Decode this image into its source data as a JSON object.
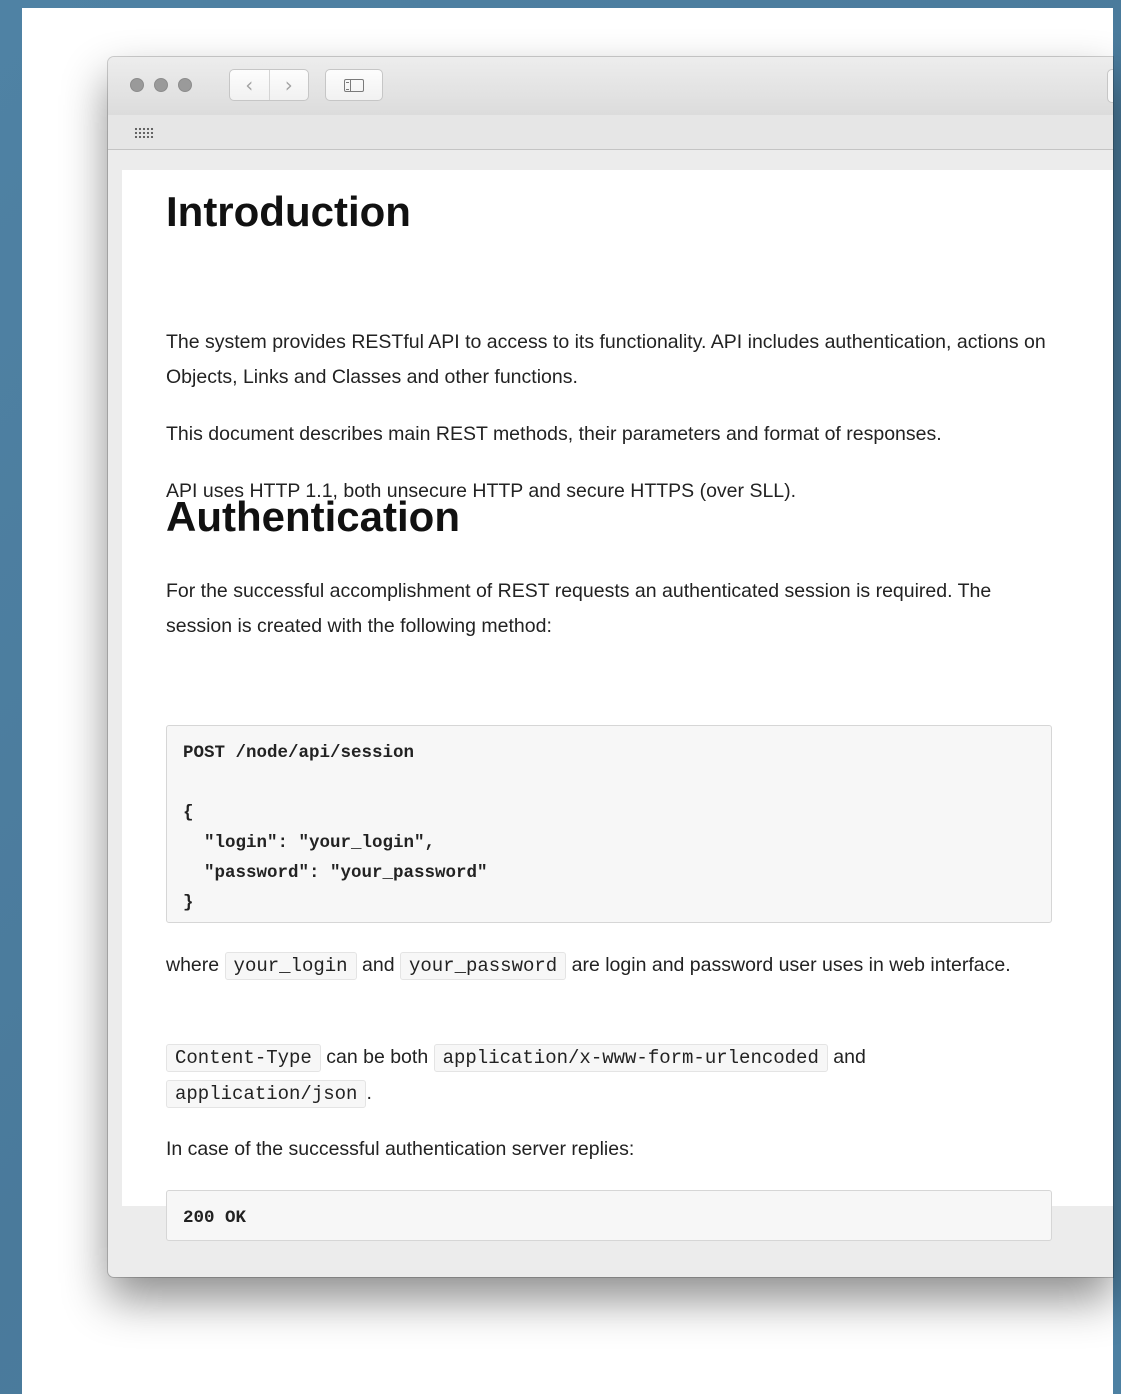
{
  "browser": {
    "back_glyph": "‹",
    "forward_glyph": "›",
    "icons": [
      "close-icon",
      "minimize-icon",
      "zoom-icon",
      "back-arrow-icon",
      "forward-arrow-icon",
      "sidebar-icon",
      "apps-grid-icon"
    ]
  },
  "doc": {
    "intro": {
      "heading": "Introduction",
      "p1": "The system provides RESTful API to access to its functionality. API includes authentication, actions on Objects, Links and Classes and other functions.",
      "p2": "This document describes main REST methods, their parameters and format of responses.",
      "p3": "API uses HTTP 1.1, both unsecure HTTP and secure HTTPS (over SLL)."
    },
    "auth": {
      "heading": "Authentication",
      "p1": "For the successful accomplishment of REST requests an authenticated session is required. The session is created with the following method:",
      "code1": "POST /node/api/session\n\n{\n  \"login\": \"your_login\",\n  \"password\": \"your_password\"\n}",
      "p2": {
        "t1": "where",
        "c1": "your_login",
        "t2": "and",
        "c2": "your_password",
        "t3": "are login and password user uses in web interface."
      },
      "p3": {
        "c1": "Content-Type",
        "t1": "can be both",
        "c2": "application/x-www-form-urlencoded",
        "t2": "and",
        "c3": "application/json",
        "t3": "."
      },
      "p4": "In case of the successful authentication server replies:",
      "code2": "200 OK"
    }
  }
}
